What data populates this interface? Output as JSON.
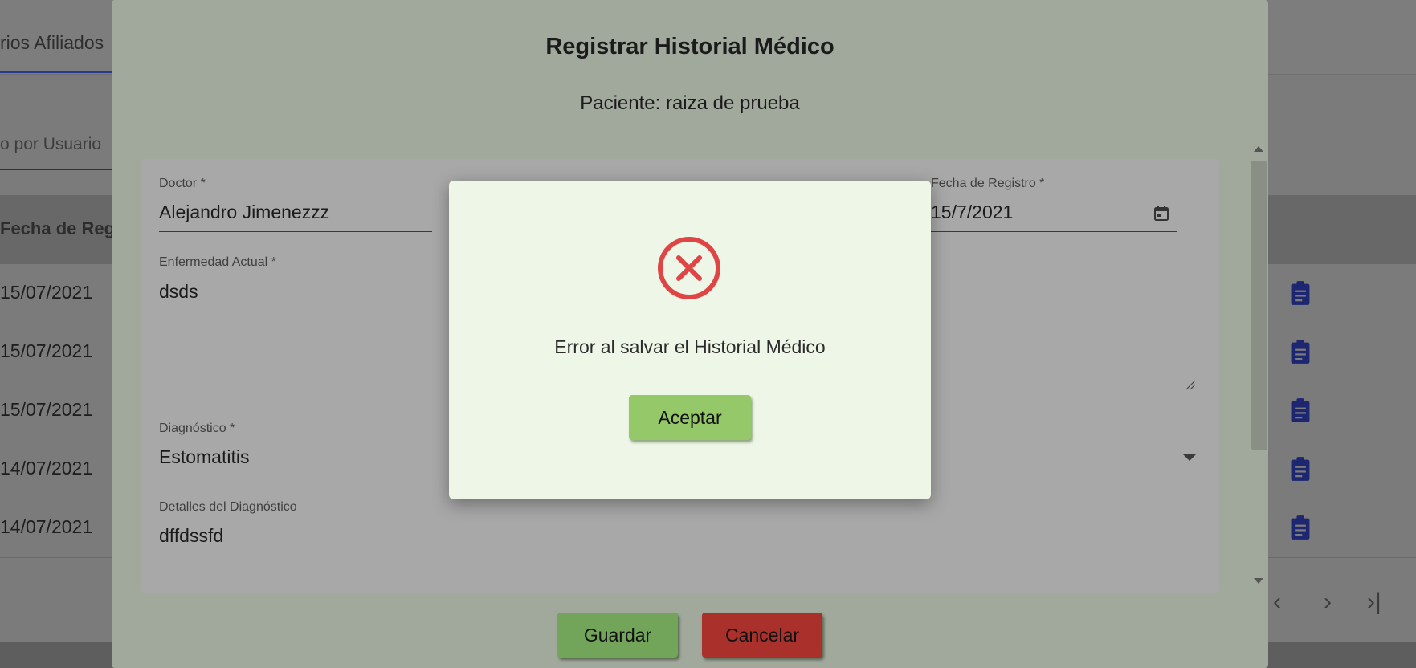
{
  "background": {
    "tab_label": "rios Afiliados",
    "filter_label": "o por Usuario",
    "table_header": "Fecha de Reg",
    "rows": [
      {
        "date": "15/07/2021",
        "icon": "clipboard-icon"
      },
      {
        "date": "15/07/2021",
        "icon": "clipboard-icon"
      },
      {
        "date": "15/07/2021",
        "icon": "clipboard-icon"
      },
      {
        "date": "14/07/2021",
        "icon": "clipboard-icon"
      },
      {
        "date": "14/07/2021",
        "icon": "clipboard-icon"
      }
    ],
    "pager": {
      "prev": "‹",
      "next": "›",
      "last": "›|"
    }
  },
  "modal": {
    "title": "Registrar Historial Médico",
    "patient_line": "Paciente: raiza de prueba",
    "fields": {
      "doctor": {
        "label": "Doctor *",
        "value": "Alejandro Jimenezzz"
      },
      "fecha": {
        "label": "Fecha de Registro *",
        "value": "15/7/2021"
      },
      "enfermedad": {
        "label": "Enfermedad Actual *",
        "value": "dsds"
      },
      "diagnostico": {
        "label": "Diagnóstico *",
        "value": "Estomatitis"
      },
      "detalles": {
        "label": "Detalles del Diagnóstico",
        "value": "dffdssfd"
      }
    },
    "buttons": {
      "save": "Guardar",
      "cancel": "Cancelar"
    }
  },
  "alert": {
    "icon": "error-x-icon",
    "message": "Error al salvar el Historial Médico",
    "accept": "Aceptar"
  },
  "colors": {
    "accent_blue": "#2a3a8f",
    "error_red": "#e04545",
    "accept_green": "#95c868",
    "save_green": "#72a55a",
    "cancel_red": "#a9302b"
  }
}
